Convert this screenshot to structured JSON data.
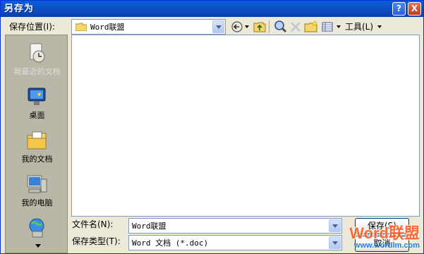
{
  "window": {
    "title": "另存为",
    "help_label": "?",
    "close_label": "X"
  },
  "toolbar": {
    "location_label": "保存位置(I):",
    "location_value": "Word联盟",
    "tools_label": "工具(L)"
  },
  "places": {
    "items": [
      {
        "label": "我最近的文档",
        "icon": "recent-documents-icon"
      },
      {
        "label": "桌面",
        "icon": "desktop-icon"
      },
      {
        "label": "我的文档",
        "icon": "my-documents-icon"
      },
      {
        "label": "我的电脑",
        "icon": "my-computer-icon"
      },
      {
        "label": "",
        "icon": "network-places-icon"
      }
    ]
  },
  "form": {
    "filename_label": "文件名(N):",
    "filename_value": "Word联盟",
    "filetype_label": "保存类型(T):",
    "filetype_value": "Word 文档 (*.doc)"
  },
  "buttons": {
    "save_label": "保存(S)",
    "cancel_label": "取消"
  },
  "watermark": {
    "brand": "Word联盟",
    "url": "www.wordlm.com"
  }
}
